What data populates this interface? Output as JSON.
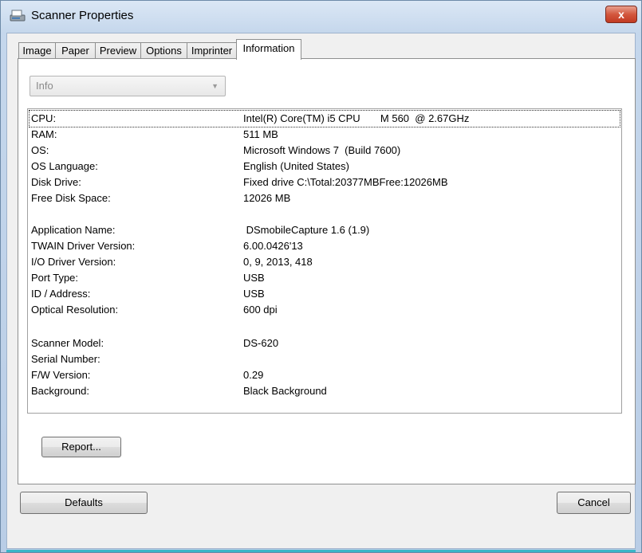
{
  "window": {
    "title": "Scanner Properties",
    "close_label": "x"
  },
  "tabs": [
    "Image",
    "Paper",
    "Preview",
    "Options",
    "Imprinter",
    "Information"
  ],
  "active_tab": "Information",
  "combo": {
    "value": "Info"
  },
  "info_rows": [
    {
      "label": "CPU:",
      "value": "Intel(R) Core(TM) i5 CPU       M 560  @ 2.67GHz"
    },
    {
      "label": "RAM:",
      "value": "511 MB"
    },
    {
      "label": "OS:",
      "value": "Microsoft Windows 7  (Build 7600)"
    },
    {
      "label": "OS Language:",
      "value": "English (United States)"
    },
    {
      "label": "Disk Drive:",
      "value": "Fixed drive C:\\Total:20377MBFree:12026MB"
    },
    {
      "label": "Free Disk Space:",
      "value": "12026 MB"
    },
    {
      "label": "Application Name:",
      "value": " DSmobileCapture 1.6 (1.9)"
    },
    {
      "label": "TWAIN Driver Version:",
      "value": "6.00.0426'13"
    },
    {
      "label": "I/O Driver Version:",
      "value": "0, 9, 2013, 418"
    },
    {
      "label": "Port Type:",
      "value": "USB"
    },
    {
      "label": "ID / Address:",
      "value": "USB"
    },
    {
      "label": "Optical Resolution:",
      "value": "600 dpi"
    },
    {
      "label": "Scanner Model:",
      "value": "DS-620"
    },
    {
      "label": "Serial Number:",
      "value": ""
    },
    {
      "label": "F/W Version:",
      "value": "0.29"
    },
    {
      "label": "Background:",
      "value": "Black Background"
    }
  ],
  "buttons": {
    "report": "Report...",
    "defaults": "Defaults",
    "cancel": "Cancel"
  }
}
